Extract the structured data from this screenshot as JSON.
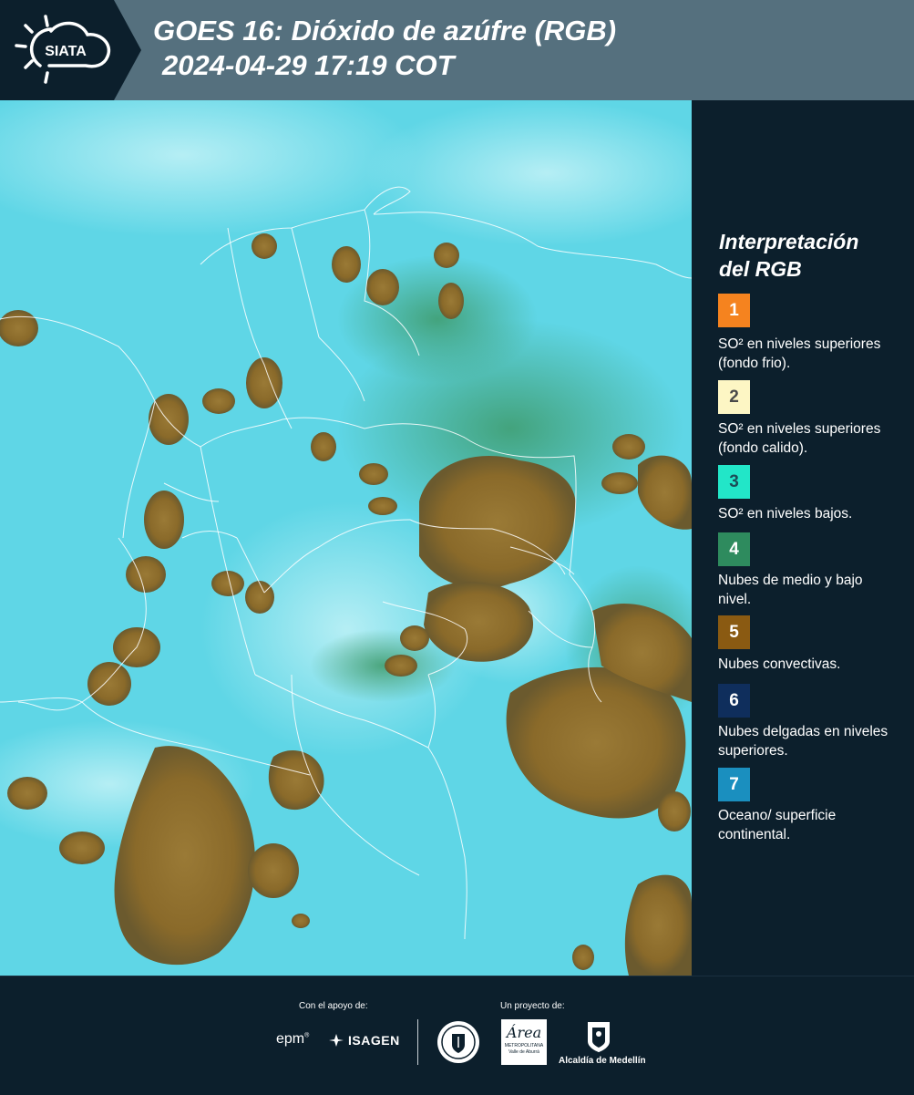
{
  "header": {
    "logo_text": "SIATA",
    "title_line1": "GOES 16: Dióxido de azúfre (RGB)",
    "title_line2": "2024-04-29 17:19 COT"
  },
  "legend": {
    "title_line1": "Interpretación",
    "title_line2": "del RGB",
    "items": [
      {
        "number": "1",
        "color": "#f5831f",
        "text_color": "#ffffff",
        "label": "SO² en niveles superiores (fondo frio)."
      },
      {
        "number": "2",
        "color": "#fdf6c4",
        "text_color": "#4a4a4a",
        "label": "SO² en niveles superiores (fondo calido)."
      },
      {
        "number": "3",
        "color": "#22e6c8",
        "text_color": "#1c4d57",
        "label": "SO² en niveles bajos."
      },
      {
        "number": "4",
        "color": "#2e8b5e",
        "text_color": "#ffffff",
        "label": "Nubes de medio y bajo nivel."
      },
      {
        "number": "5",
        "color": "#8a5a12",
        "text_color": "#ffffff",
        "label": "Nubes convectivas."
      },
      {
        "number": "6",
        "color": "#0f2e5c",
        "text_color": "#ffffff",
        "label": "Nubes delgadas en niveles superiores."
      },
      {
        "number": "7",
        "color": "#1a8fbf",
        "text_color": "#ffffff",
        "label": "Oceano/ superficie continental."
      }
    ]
  },
  "footer": {
    "support_label": "Con el apoyo de:",
    "project_label": "Un proyecto de:",
    "sponsor_epm": "epm",
    "sponsor_isagen": "ISAGEN",
    "area_metro_name": "Área",
    "area_metro_line1": "METROPOLITANA",
    "area_metro_line2": "Valle de Aburrá",
    "alcaldia": "Alcaldía de Medellín"
  },
  "colors": {
    "background": "#0c1f2c",
    "header_band": "#55707e",
    "map_clear": "#5fd6e6",
    "convective": "#8a6a2a",
    "midlevel": "#3e9a6a"
  }
}
